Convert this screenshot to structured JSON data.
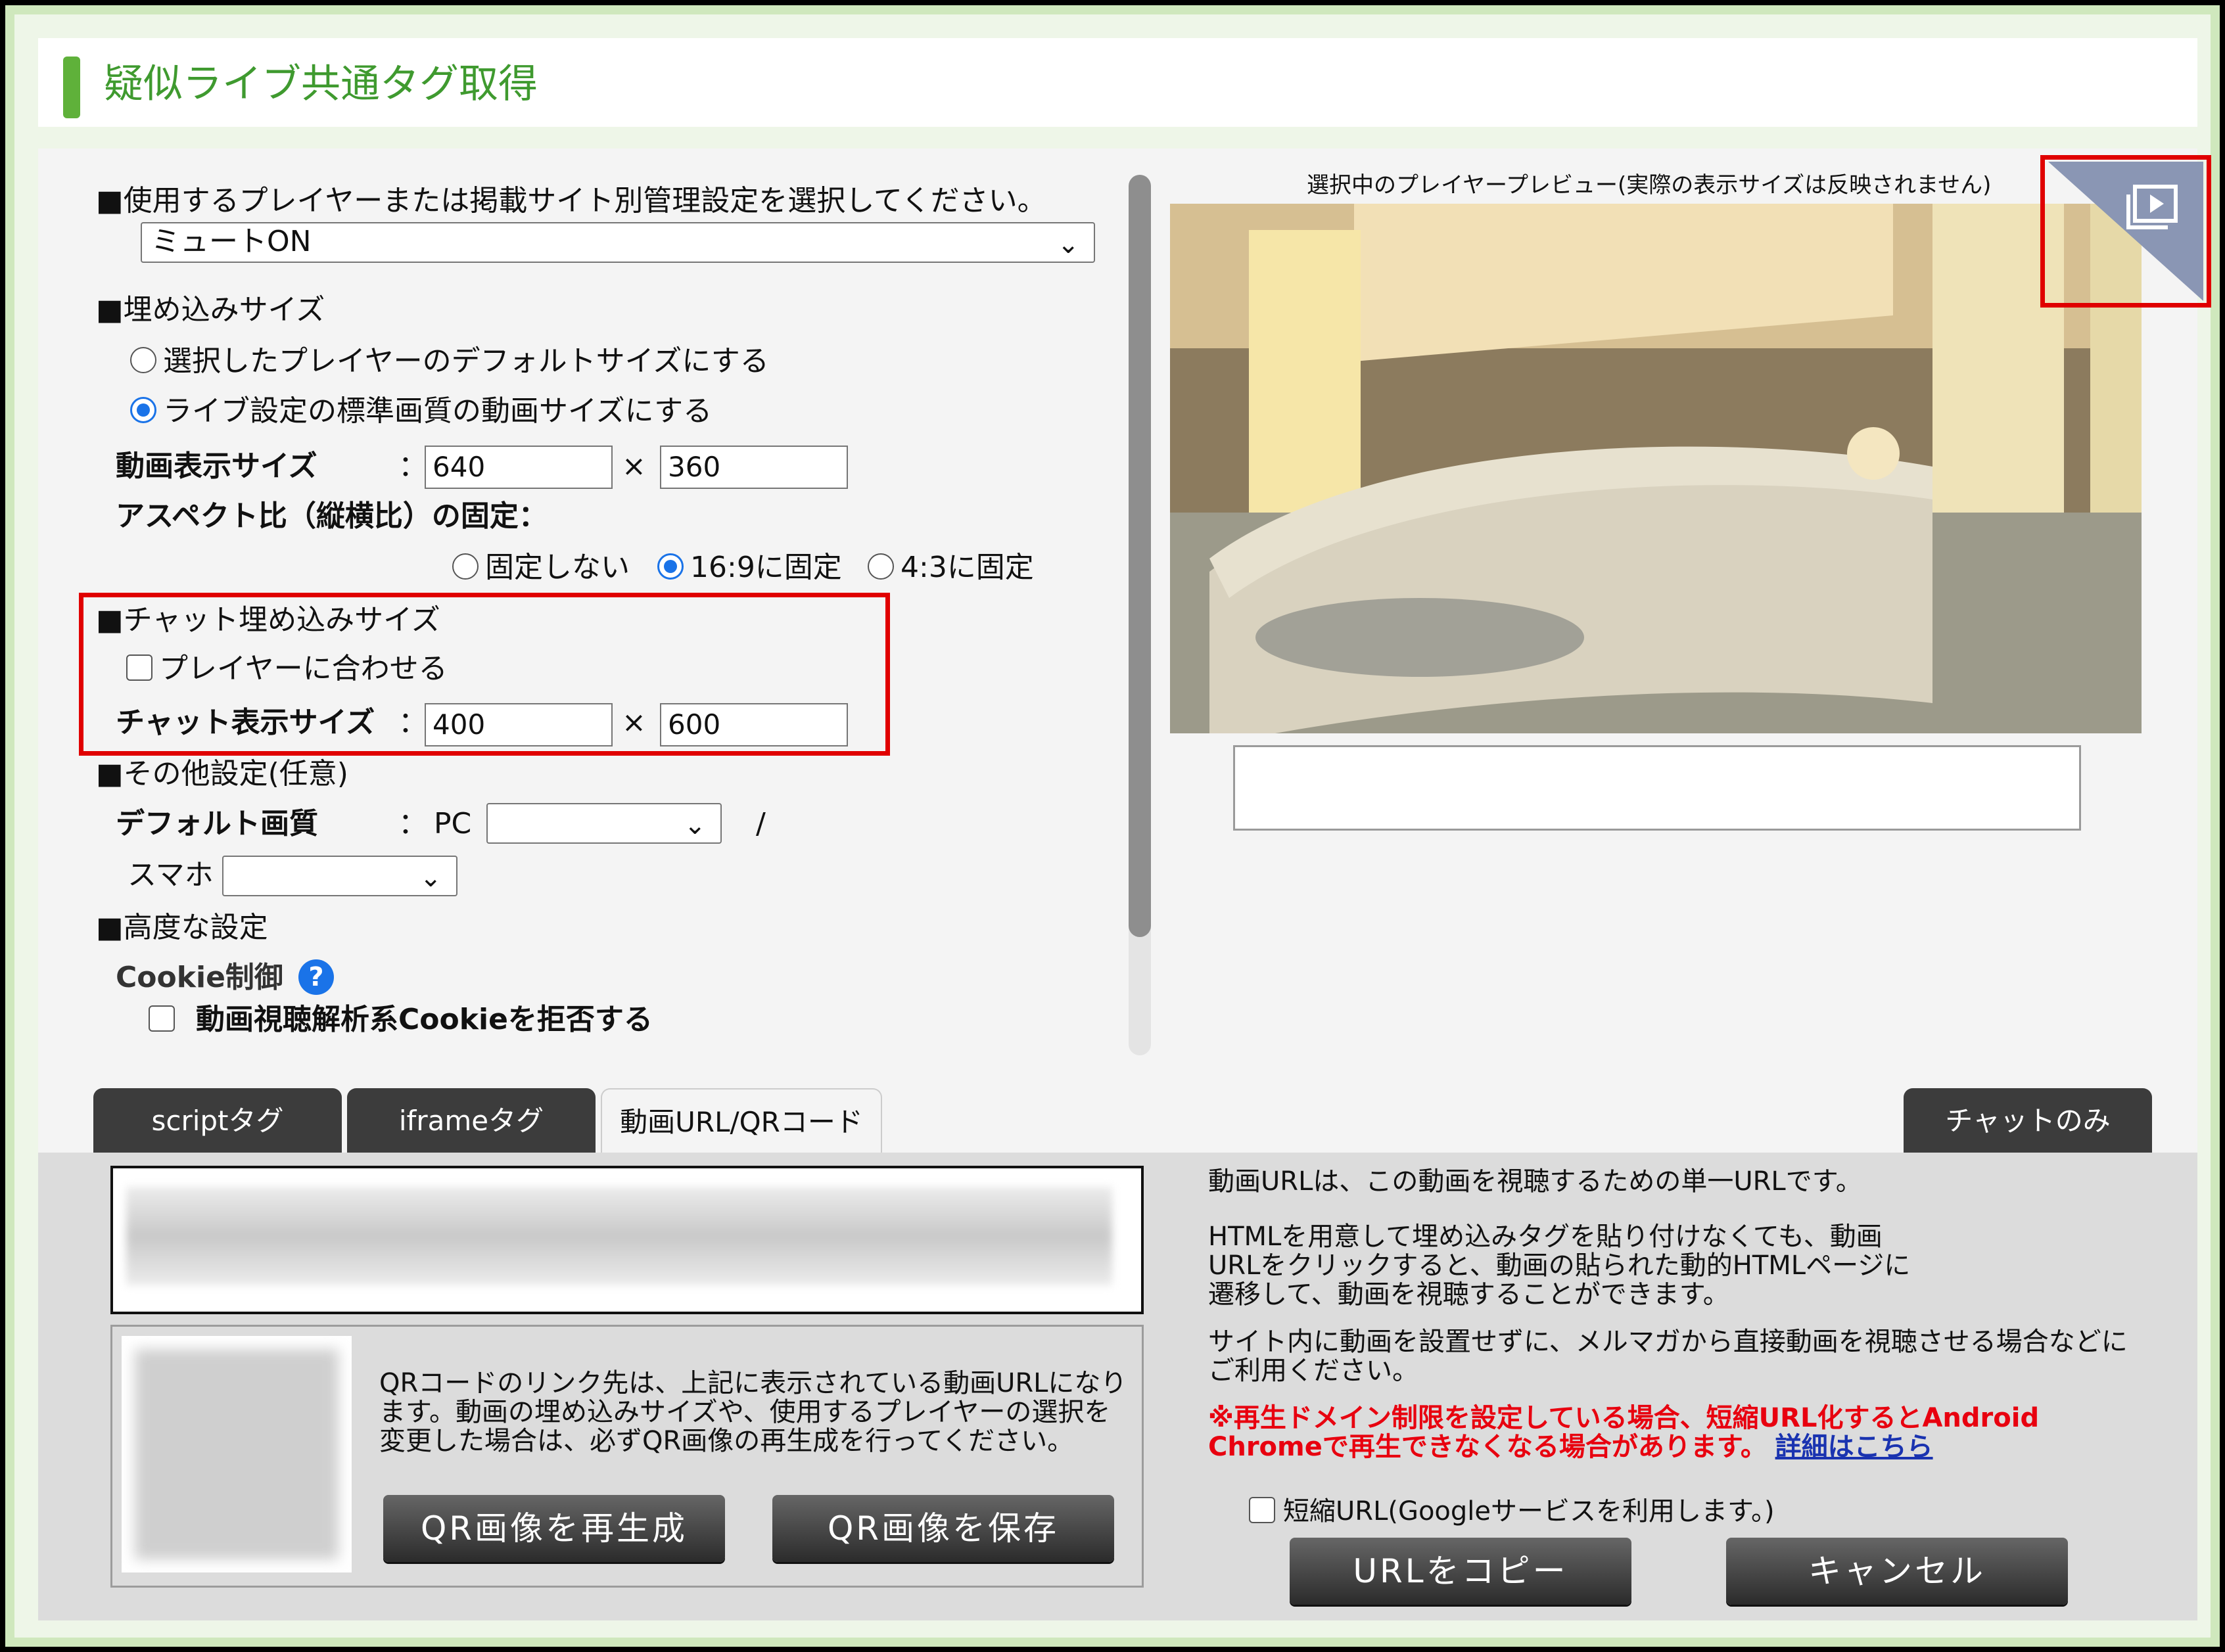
{
  "page_title": "疑似ライブ共通タグ取得",
  "player_section": {
    "label": "■使用するプレイヤーまたは掲載サイト別管理設定を選択してください。",
    "selected": "ミュートON"
  },
  "embed_size": {
    "label": "■埋め込みサイズ",
    "option_default": "選択したプレイヤーのデフォルトサイズにする",
    "option_live": "ライブ設定の標準画質の動画サイズにする",
    "video_size_label": "動画表示サイズ",
    "colon": "：",
    "times": "×",
    "width": "640",
    "height": "360",
    "aspect_label": "アスペクト比（縦横比）の固定：",
    "aspect_none": "固定しない",
    "aspect_169": "16:9に固定",
    "aspect_43": "4:3に固定"
  },
  "chat_size": {
    "label": "■チャット埋め込みサイズ",
    "fit_player": "プレイヤーに合わせる",
    "size_label": "チャット表示サイズ",
    "width": "400",
    "height": "600"
  },
  "other": {
    "label": "■その他設定(任意)",
    "quality_label": "デフォルト画質",
    "pc_label": "PC",
    "slash": "/",
    "phone_label": "スマホ"
  },
  "advanced": {
    "label": "■高度な設定",
    "cookie_label": "Cookie制御",
    "help_icon": "?",
    "cookie_option": "動画視聴解析系Cookieを拒否する"
  },
  "preview": {
    "caption": "選択中のプレイヤープレビュー(実際の表示サイズは反映されません)"
  },
  "tabs": {
    "script": "scriptタグ",
    "iframe": "iframeタグ",
    "url_qr": "動画URL/QRコード",
    "chat_only": "チャットのみ"
  },
  "qr": {
    "description": "QRコードのリンク先は、上記に表示されている動画URLになります。動画の埋め込みサイズや、使用するプレイヤーの選択を変更した場合は、必ずQR画像の再生成を行ってください。",
    "regenerate": "QR画像を再生成",
    "save": "QR画像を保存"
  },
  "info": {
    "p1": "動画URLは、この動画を視聴するための単一URLです。",
    "p2": "HTMLを用意して埋め込みタグを貼り付けなくても、動画URLをクリックすると、動画の貼られた動的HTMLページに遷移して、動画を視聴することができます。",
    "p3": "サイト内に動画を設置せずに、メルマガから直接動画を視聴させる場合などにご利用ください。",
    "warning": "※再生ドメイン制限を設定している場合、短縮URL化するとAndroid Chromeで再生できなくなる場合があります。",
    "link": "詳細はこちら",
    "short_url": "短縮URL(Googleサービスを利用します。)",
    "copy": "URLをコピー",
    "cancel": "キャンセル"
  }
}
